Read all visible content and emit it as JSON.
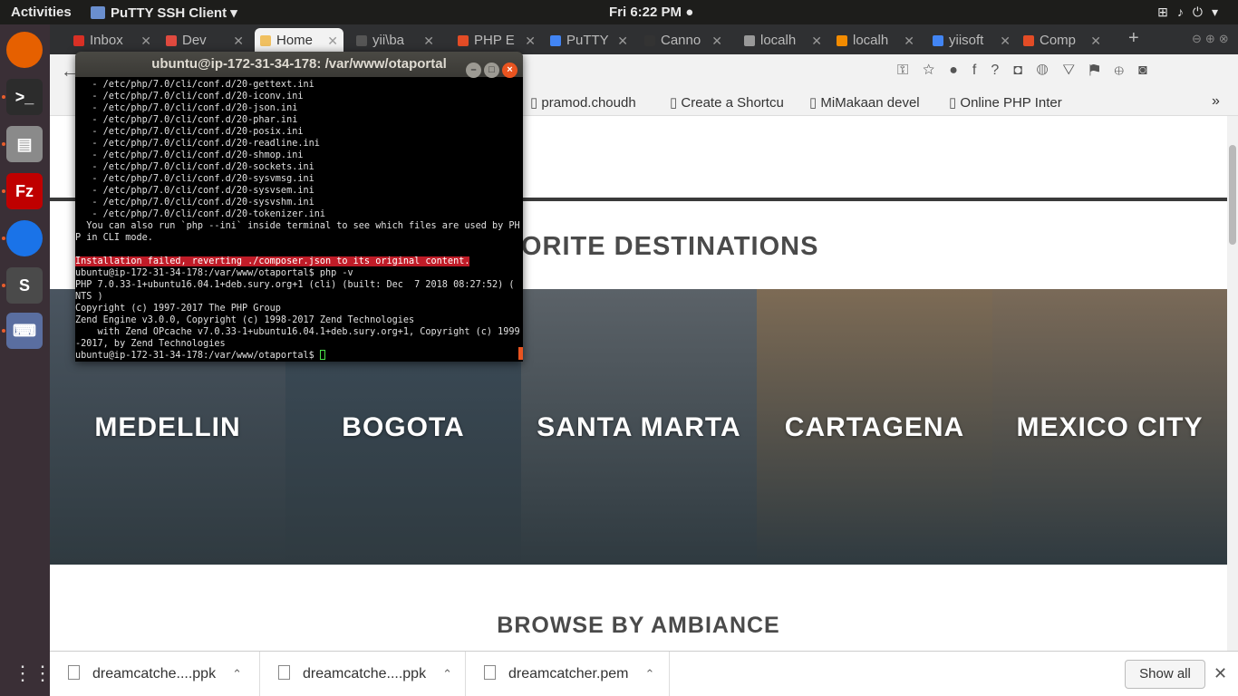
{
  "topbar": {
    "activities": "Activities",
    "app_name": "PuTTY SSH Client",
    "clock": "Fri  6:22 PM"
  },
  "launcher": {
    "items": [
      {
        "name": "firefox-icon",
        "glyph": "",
        "color": "#e66000"
      },
      {
        "name": "terminal-icon",
        "glyph": ">_",
        "color": "#2c2c2c"
      },
      {
        "name": "files-icon",
        "glyph": "▤",
        "color": "#8a8a8a"
      },
      {
        "name": "filezilla-icon",
        "glyph": "Fz",
        "color": "#bf0000"
      },
      {
        "name": "chrome-icon",
        "glyph": "",
        "color": "#1a73e8"
      },
      {
        "name": "sublime-icon",
        "glyph": "S",
        "color": "#4a4a4a"
      },
      {
        "name": "putty-icon",
        "glyph": "⌨",
        "color": "#5a6ea0"
      }
    ]
  },
  "tabs": [
    {
      "label": "Inbox",
      "fav": "#d93025"
    },
    {
      "label": "Dev",
      "fav": "#e04a3f"
    },
    {
      "label": "Home",
      "fav": "#f0c060"
    },
    {
      "label": "yii\\ba",
      "fav": "#555555"
    },
    {
      "label": "PHP E",
      "fav": "#e34c26"
    },
    {
      "label": "PuTTY",
      "fav": "#4285f4"
    },
    {
      "label": "Canno",
      "fav": "#333333"
    },
    {
      "label": "localh",
      "fav": "#999999"
    },
    {
      "label": "localh",
      "fav": "#f28b00"
    },
    {
      "label": "yiisoft",
      "fav": "#4285f4"
    },
    {
      "label": "Comp",
      "fav": "#e34c26"
    }
  ],
  "bookmarks": [
    "pramod.choudh",
    "Create a Shortcu",
    "MiMakaan devel",
    "Online PHP Inter"
  ],
  "page": {
    "favorite_title": "ORITE DESTINATIONS",
    "destinations": [
      {
        "name": "MEDELLIN",
        "bg": "#4a5560"
      },
      {
        "name": "BOGOTA",
        "bg": "#3d4d5a"
      },
      {
        "name": "SANTA MARTA",
        "bg": "#5b6268"
      },
      {
        "name": "CARTAGENA",
        "bg": "#7d6b55"
      },
      {
        "name": "MEXICO CITY",
        "bg": "#7a6a58"
      }
    ],
    "ambiance_title": "BROWSE BY AMBIANCE"
  },
  "terminal": {
    "title": "ubuntu@ip-172-31-34-178: /var/www/otaportal",
    "lines_before": "   - /etc/php/7.0/cli/conf.d/20-gettext.ini\n   - /etc/php/7.0/cli/conf.d/20-iconv.ini\n   - /etc/php/7.0/cli/conf.d/20-json.ini\n   - /etc/php/7.0/cli/conf.d/20-phar.ini\n   - /etc/php/7.0/cli/conf.d/20-posix.ini\n   - /etc/php/7.0/cli/conf.d/20-readline.ini\n   - /etc/php/7.0/cli/conf.d/20-shmop.ini\n   - /etc/php/7.0/cli/conf.d/20-sockets.ini\n   - /etc/php/7.0/cli/conf.d/20-sysvmsg.ini\n   - /etc/php/7.0/cli/conf.d/20-sysvsem.ini\n   - /etc/php/7.0/cli/conf.d/20-sysvshm.ini\n   - /etc/php/7.0/cli/conf.d/20-tokenizer.ini\n  You can also run `php --ini` inside terminal to see which files are used by PH\nP in CLI mode.\n",
    "error_line": "Installation failed, reverting ./composer.json to its original content.",
    "lines_after": "ubuntu@ip-172-31-34-178:/var/www/otaportal$ php -v\nPHP 7.0.33-1+ubuntu16.04.1+deb.sury.org+1 (cli) (built: Dec  7 2018 08:27:52) (\nNTS )\nCopyright (c) 1997-2017 The PHP Group\nZend Engine v3.0.0, Copyright (c) 1998-2017 Zend Technologies\n    with Zend OPcache v7.0.33-1+ubuntu16.04.1+deb.sury.org+1, Copyright (c) 1999\n-2017, by Zend Technologies",
    "prompt": "ubuntu@ip-172-31-34-178:/var/www/otaportal$ "
  },
  "downloads": {
    "files": [
      "dreamcatche....ppk",
      "dreamcatche....ppk",
      "dreamcatcher.pem"
    ],
    "show_all": "Show all"
  }
}
